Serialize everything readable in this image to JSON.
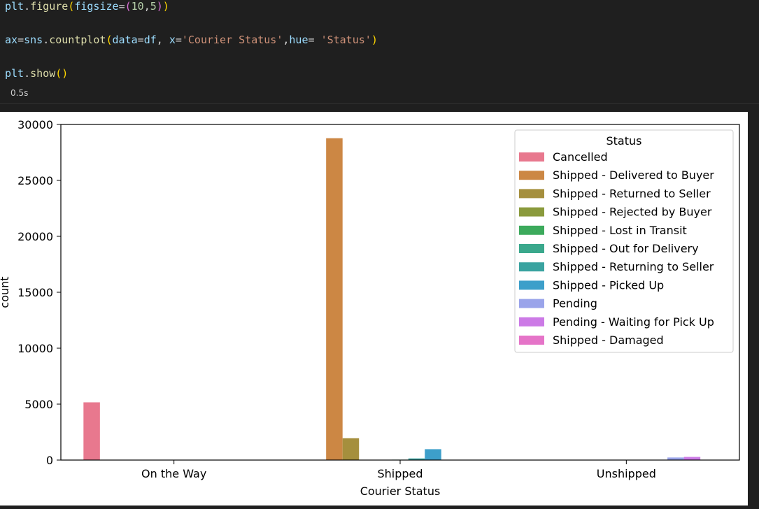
{
  "code": {
    "line1": [
      {
        "t": "plt",
        "c": "tok-var"
      },
      {
        "t": ".",
        "c": "tok-op"
      },
      {
        "t": "figure",
        "c": "tok-fn"
      },
      {
        "t": "(",
        "c": "tok-p1"
      },
      {
        "t": "figsize",
        "c": "tok-var"
      },
      {
        "t": "=",
        "c": "tok-op"
      },
      {
        "t": "(",
        "c": "tok-p2"
      },
      {
        "t": "10",
        "c": "tok-num"
      },
      {
        "t": ",",
        "c": "tok-op"
      },
      {
        "t": "5",
        "c": "tok-num"
      },
      {
        "t": ")",
        "c": "tok-p2"
      },
      {
        "t": ")",
        "c": "tok-p1"
      }
    ],
    "line2": [
      {
        "t": "ax",
        "c": "tok-var"
      },
      {
        "t": "=",
        "c": "tok-op"
      },
      {
        "t": "sns",
        "c": "tok-var"
      },
      {
        "t": ".",
        "c": "tok-op"
      },
      {
        "t": "countplot",
        "c": "tok-fn"
      },
      {
        "t": "(",
        "c": "tok-p1"
      },
      {
        "t": "data",
        "c": "tok-var"
      },
      {
        "t": "=",
        "c": "tok-op"
      },
      {
        "t": "df",
        "c": "tok-var"
      },
      {
        "t": ", ",
        "c": "tok-op"
      },
      {
        "t": "x",
        "c": "tok-var"
      },
      {
        "t": "=",
        "c": "tok-op"
      },
      {
        "t": "'Courier Status'",
        "c": "tok-str"
      },
      {
        "t": ",",
        "c": "tok-op"
      },
      {
        "t": "hue",
        "c": "tok-var"
      },
      {
        "t": "= ",
        "c": "tok-op"
      },
      {
        "t": "'Status'",
        "c": "tok-str"
      },
      {
        "t": ")",
        "c": "tok-p1"
      }
    ],
    "line3": [
      {
        "t": "plt",
        "c": "tok-var"
      },
      {
        "t": ".",
        "c": "tok-op"
      },
      {
        "t": "show",
        "c": "tok-fn"
      },
      {
        "t": "()",
        "c": "tok-p1"
      }
    ],
    "exec_time": "0.5s"
  },
  "chart_data": {
    "type": "bar",
    "categories": [
      "On the Way",
      "Shipped",
      "Unshipped"
    ],
    "xlabel": "Courier Status",
    "ylabel": "count",
    "ylim": [
      0,
      30000
    ],
    "yticks": [
      0,
      5000,
      10000,
      15000,
      20000,
      25000,
      30000
    ],
    "grid": false,
    "legend": {
      "title": "Status",
      "placement": "top-right"
    },
    "series": [
      {
        "name": "Cancelled",
        "color": "#e8788e",
        "values": [
          5160,
          0,
          0
        ]
      },
      {
        "name": "Shipped - Delivered to Buyer",
        "color": "#cc8744",
        "values": [
          0,
          28770,
          0
        ]
      },
      {
        "name": "Shipped - Returned to Seller",
        "color": "#a58f3d",
        "values": [
          0,
          1950,
          0
        ]
      },
      {
        "name": "Shipped - Rejected by Buyer",
        "color": "#8a9a3c",
        "values": [
          0,
          11,
          0
        ]
      },
      {
        "name": "Shipped - Lost in Transit",
        "color": "#3caa5c",
        "values": [
          0,
          5,
          0
        ]
      },
      {
        "name": "Shipped - Out for Delivery",
        "color": "#3aa88c",
        "values": [
          0,
          35,
          0
        ]
      },
      {
        "name": "Shipped - Returning to Seller",
        "color": "#3aa3a0",
        "values": [
          0,
          145,
          0
        ]
      },
      {
        "name": "Shipped - Picked Up",
        "color": "#3d9fca",
        "values": [
          0,
          973,
          0
        ]
      },
      {
        "name": "Pending",
        "color": "#9aa4ea",
        "values": [
          0,
          0,
          230
        ]
      },
      {
        "name": "Pending - Waiting for Pick Up",
        "color": "#cc7ae6",
        "values": [
          0,
          0,
          281
        ]
      },
      {
        "name": "Shipped - Damaged",
        "color": "#e574c8",
        "values": [
          0,
          1,
          0
        ]
      }
    ]
  }
}
